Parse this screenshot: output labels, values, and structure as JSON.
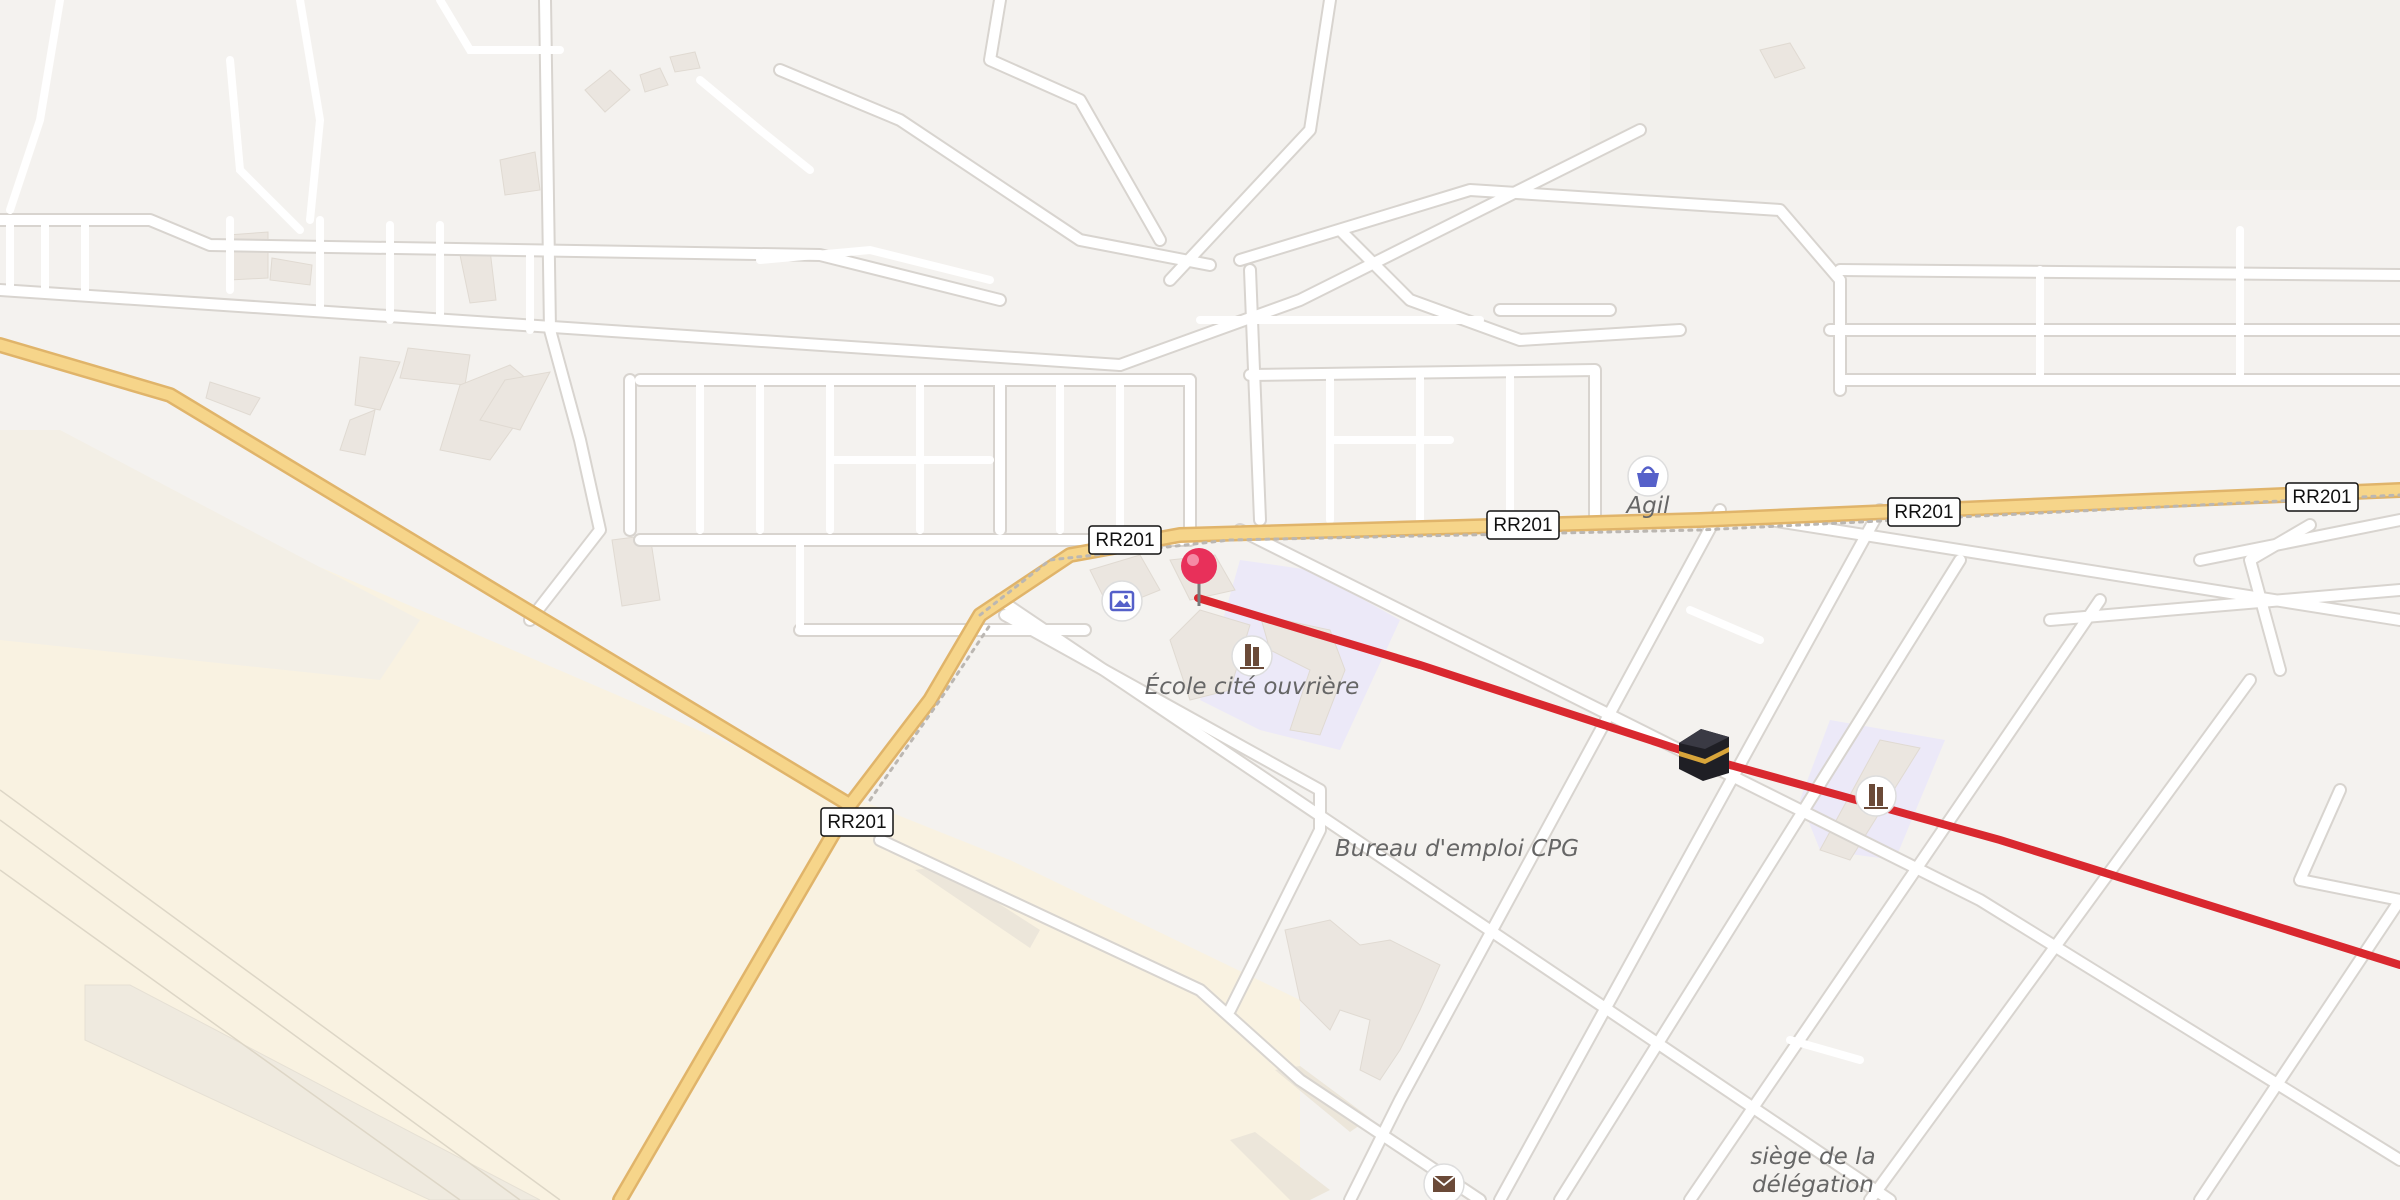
{
  "map": {
    "road_shields": [
      {
        "id": "rr201-a",
        "text": "RR201"
      },
      {
        "id": "rr201-b",
        "text": "RR201"
      },
      {
        "id": "rr201-c",
        "text": "RR201"
      },
      {
        "id": "rr201-d",
        "text": "RR201"
      },
      {
        "id": "rr201-e",
        "text": "RR201"
      }
    ],
    "labels": {
      "agil": "Agil",
      "ecole": "École cité ouvrière",
      "bureau": "Bureau d'emploi CPG",
      "siege_line1": "siège de la",
      "siege_line2": "délégation"
    },
    "icons": {
      "shop": "shopping-basket-icon",
      "gallery": "picture-icon",
      "school": "school-icon",
      "school2": "school-icon",
      "kaaba": "kaaba-icon",
      "post": "envelope-icon",
      "pin": "location-pin-icon"
    },
    "colors": {
      "route": "#d9282f",
      "pin": "#e8305a",
      "main_road": "#f6d58a",
      "industrial": "#faf3df",
      "school_area": "#ece9f8",
      "poi_icon": "#5560c9"
    }
  }
}
